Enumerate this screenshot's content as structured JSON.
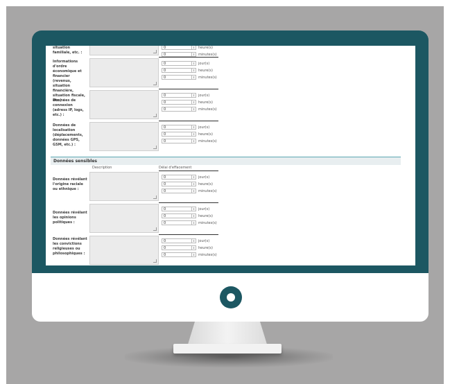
{
  "units": {
    "days": "jour(s)",
    "hours": "heure(s)",
    "minutes": "minutes(s)"
  },
  "rows_top": [
    {
      "label": "situation familiale, etc. :",
      "values": [
        "0",
        "0"
      ],
      "partial": true
    },
    {
      "label": "Informations d'ordre économique et financier (revenus, situation financière, situation fiscale, etc.) :",
      "values": [
        "0",
        "0",
        "0"
      ]
    },
    {
      "label": "Données de connexion (adress IP, logs, etc.) :",
      "values": [
        "0",
        "0",
        "0"
      ]
    },
    {
      "label": "Données de localisation (déplacements, données GPS, GSM, etc.) :",
      "values": [
        "0",
        "0",
        "0"
      ]
    }
  ],
  "sensitive_section": {
    "title": "Données sensibles",
    "col_description": "Description",
    "col_delay": "Délai d'effacement",
    "rows": [
      {
        "label": "Données révélant l'origine raciale ou ethnique :",
        "values": [
          "0",
          "0",
          "0"
        ]
      },
      {
        "label": "Données révélant les opinions politiques :",
        "values": [
          "0",
          "0",
          "0"
        ]
      },
      {
        "label": "Données révélant les convictions religieuses ou philosophiques :",
        "values": [
          "0",
          "0",
          "0"
        ]
      }
    ]
  }
}
